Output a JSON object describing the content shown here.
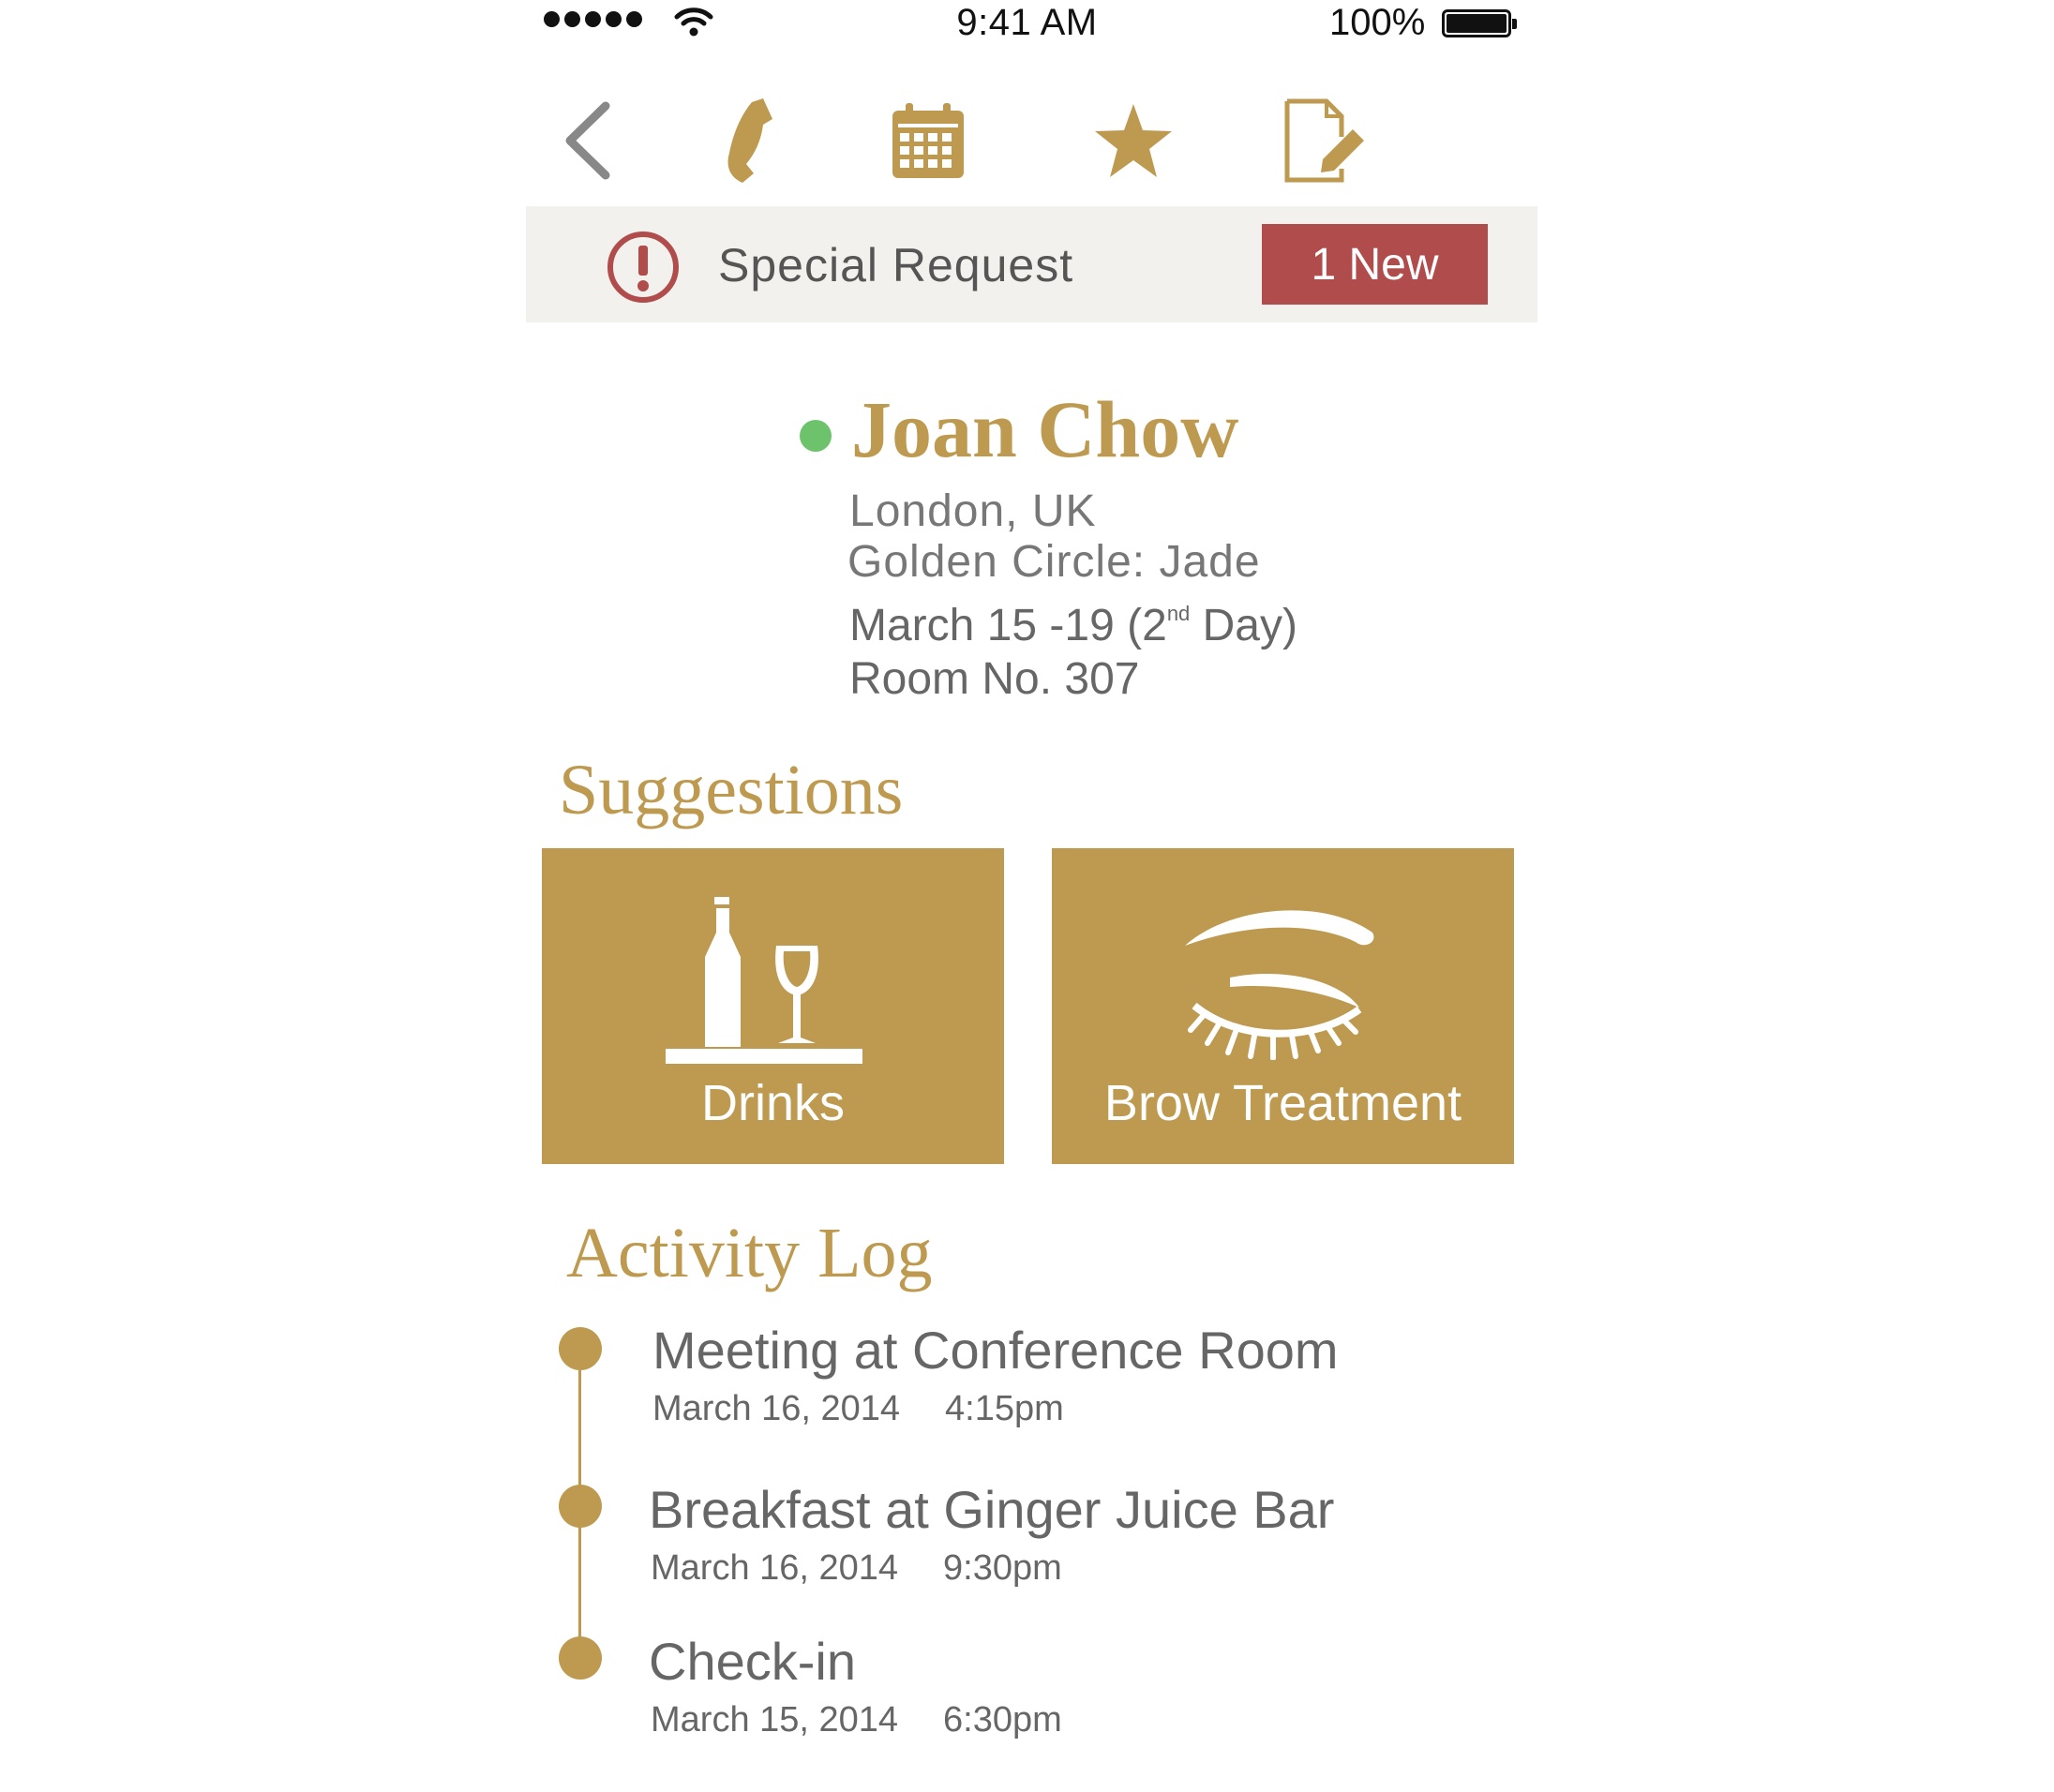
{
  "status_bar": {
    "time": "9:41 AM",
    "battery": "100%"
  },
  "toolbar": {
    "icons": [
      "back-chevron-icon",
      "phone-icon",
      "calendar-icon",
      "star-icon",
      "edit-note-icon"
    ]
  },
  "special_request": {
    "label": "Special Request",
    "badge": "1 New"
  },
  "guest": {
    "name": "Joan Chow",
    "location": "London, UK",
    "tier": "Golden Circle: Jade",
    "dates_main": "March 15 -19 (2",
    "dates_sup": "nd",
    "dates_end": " Day)",
    "room": "Room No. 307",
    "status_color": "#6cc36c"
  },
  "suggestions": {
    "title": "Suggestions",
    "items": [
      {
        "label": "Drinks",
        "icon": "drinks-icon"
      },
      {
        "label": "Brow Treatment",
        "icon": "eye-brow-icon"
      }
    ]
  },
  "activity": {
    "title": "Activity Log",
    "items": [
      {
        "title": "Meeting at Conference Room",
        "date": "March 16, 2014",
        "time": "4:15pm"
      },
      {
        "title": "Breakfast at Ginger Juice Bar",
        "date": "March 16, 2014",
        "time": "9:30pm"
      },
      {
        "title": "Check-in",
        "date": "March 15, 2014",
        "time": "6:30pm"
      }
    ]
  },
  "colors": {
    "accent": "#bd9a4f",
    "alert": "#b04d4c",
    "bar_bg": "#f3f1ed"
  }
}
